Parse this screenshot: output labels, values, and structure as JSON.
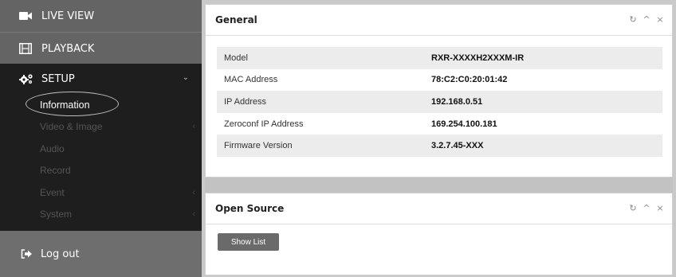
{
  "sidebar": {
    "live_view": "LIVE VIEW",
    "playback": "PLAYBACK",
    "setup": "SETUP",
    "setup_items": [
      {
        "label": "Information",
        "active": true
      },
      {
        "label": "Video & Image",
        "has_submenu": true
      },
      {
        "label": "Audio",
        "has_submenu": false
      },
      {
        "label": "Record",
        "has_submenu": false
      },
      {
        "label": "Event",
        "has_submenu": true
      },
      {
        "label": "System",
        "has_submenu": true
      }
    ],
    "logout": "Log out",
    "icons": {
      "live_view": "video-camera-icon",
      "playback": "film-icon",
      "setup": "gears-icon",
      "logout": "sign-out-icon",
      "expand": "chevron-down-icon",
      "submenu": "chevron-left-icon"
    }
  },
  "general": {
    "title": "General",
    "rows": [
      {
        "key": "Model",
        "value": "RXR-XXXXH2XXXM-IR"
      },
      {
        "key": "MAC Address",
        "value": "78:C2:C0:20:01:42"
      },
      {
        "key": "IP Address",
        "value": "192.168.0.51"
      },
      {
        "key": "Zeroconf IP Address",
        "value": "169.254.100.181"
      },
      {
        "key": "Firmware Version",
        "value": "3.2.7.45-XXX"
      }
    ]
  },
  "open_source": {
    "title": "Open Source",
    "button": "Show List"
  },
  "panel_tools": {
    "refresh": "↻",
    "collapse": "^",
    "close": "×"
  },
  "colors": {
    "sidebar_bg": "#6e6e6e",
    "setup_bg": "#1e1e1e",
    "panel_bg": "#ffffff",
    "row_alt": "#ececec",
    "button_bg": "#6a6a6a"
  }
}
